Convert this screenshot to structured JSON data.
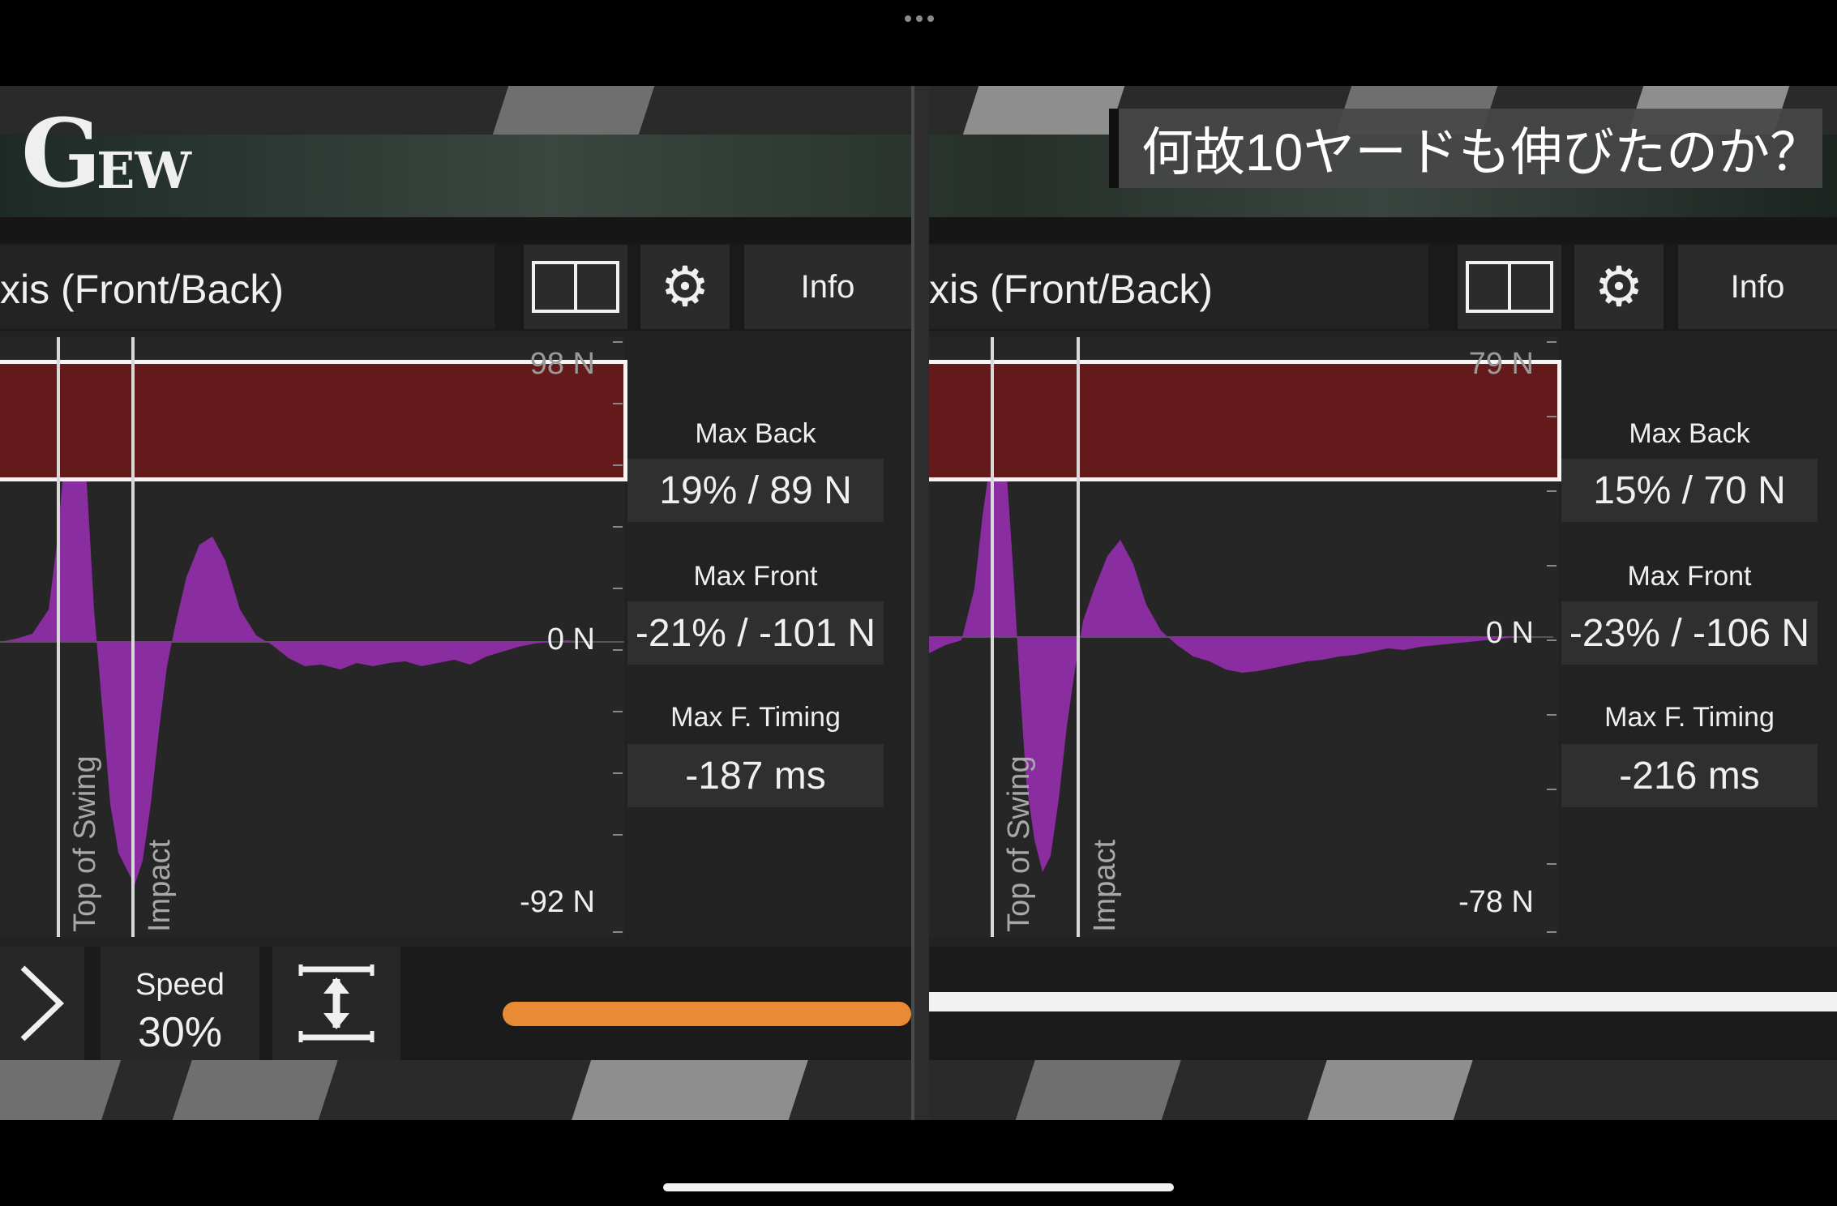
{
  "app": {
    "logo_text_big": "G",
    "logo_text_small": "EW",
    "caption": "何故10ヤードも伸びたのか？"
  },
  "colors": {
    "waveform": "#8a2da0",
    "redbox": "#641a1a",
    "progress_left": "#e98a34",
    "progress_right": "#f2f2f2"
  },
  "left": {
    "title": "xis (Front/Back)",
    "info_label": "Info",
    "split_icon": "split-view-icon",
    "gear_icon": "gear-icon",
    "y_top": "98 N",
    "y_zero": "0 N",
    "y_bottom": "-92 N",
    "marker_top": "Top of Swing",
    "marker_impact": "Impact",
    "max_back_label": "Max Back",
    "max_back_value": "19% / 89 N",
    "max_front_label": "Max Front",
    "max_front_value": "-21% / -101 N",
    "max_timing_label": "Max F. Timing",
    "max_timing_value": "-187 ms",
    "speed_label": "Speed",
    "speed_value": "30%"
  },
  "right": {
    "title": "xis (Front/Back)",
    "info_label": "Info",
    "split_icon": "split-view-icon",
    "gear_icon": "gear-icon",
    "y_top": "79 N",
    "y_zero": "0 N",
    "y_bottom": "-78 N",
    "marker_top": "Top of Swing",
    "marker_impact": "Impact",
    "max_back_label": "Max Back",
    "max_back_value": "15% / 70 N",
    "max_front_label": "Max Front",
    "max_front_value": "-23% / -106 N",
    "max_timing_label": "Max F. Timing",
    "max_timing_value": "-216 ms"
  },
  "waveforms": {
    "left": [
      [
        0,
        0
      ],
      [
        20,
        4
      ],
      [
        40,
        10
      ],
      [
        60,
        40
      ],
      [
        70,
        120
      ],
      [
        80,
        230
      ],
      [
        90,
        300
      ],
      [
        100,
        310
      ],
      [
        108,
        180
      ],
      [
        116,
        40
      ],
      [
        126,
        -80
      ],
      [
        136,
        -200
      ],
      [
        146,
        -260
      ],
      [
        156,
        -280
      ],
      [
        166,
        -300
      ],
      [
        176,
        -270
      ],
      [
        186,
        -200
      ],
      [
        196,
        -110
      ],
      [
        206,
        -30
      ],
      [
        216,
        20
      ],
      [
        230,
        80
      ],
      [
        246,
        120
      ],
      [
        262,
        130
      ],
      [
        278,
        100
      ],
      [
        296,
        40
      ],
      [
        316,
        8
      ],
      [
        336,
        -4
      ],
      [
        356,
        -20
      ],
      [
        376,
        -30
      ],
      [
        396,
        -28
      ],
      [
        420,
        -34
      ],
      [
        440,
        -26
      ],
      [
        460,
        -30
      ],
      [
        480,
        -26
      ],
      [
        500,
        -24
      ],
      [
        520,
        -30
      ],
      [
        540,
        -26
      ],
      [
        560,
        -22
      ],
      [
        580,
        -28
      ],
      [
        600,
        -18
      ],
      [
        620,
        -12
      ],
      [
        640,
        -6
      ],
      [
        660,
        -2
      ],
      [
        680,
        0
      ],
      [
        700,
        2
      ],
      [
        720,
        0
      ],
      [
        750,
        0
      ]
    ],
    "right": [
      [
        0,
        -20
      ],
      [
        20,
        -10
      ],
      [
        40,
        -4
      ],
      [
        56,
        60
      ],
      [
        66,
        150
      ],
      [
        76,
        220
      ],
      [
        86,
        240
      ],
      [
        96,
        200
      ],
      [
        104,
        80
      ],
      [
        112,
        -60
      ],
      [
        120,
        -180
      ],
      [
        130,
        -250
      ],
      [
        140,
        -290
      ],
      [
        150,
        -270
      ],
      [
        160,
        -200
      ],
      [
        170,
        -110
      ],
      [
        180,
        -40
      ],
      [
        190,
        20
      ],
      [
        204,
        60
      ],
      [
        220,
        100
      ],
      [
        236,
        120
      ],
      [
        252,
        90
      ],
      [
        268,
        40
      ],
      [
        286,
        8
      ],
      [
        306,
        -10
      ],
      [
        326,
        -24
      ],
      [
        346,
        -30
      ],
      [
        366,
        -40
      ],
      [
        386,
        -44
      ],
      [
        406,
        -42
      ],
      [
        426,
        -38
      ],
      [
        446,
        -34
      ],
      [
        466,
        -30
      ],
      [
        486,
        -28
      ],
      [
        506,
        -24
      ],
      [
        526,
        -22
      ],
      [
        546,
        -18
      ],
      [
        566,
        -14
      ],
      [
        586,
        -16
      ],
      [
        606,
        -12
      ],
      [
        626,
        -10
      ],
      [
        646,
        -8
      ],
      [
        666,
        -6
      ],
      [
        686,
        -4
      ],
      [
        706,
        -2
      ],
      [
        726,
        0
      ],
      [
        750,
        0
      ]
    ]
  },
  "progress": {
    "left_fraction": 1.0,
    "right_fraction": 1.0
  }
}
